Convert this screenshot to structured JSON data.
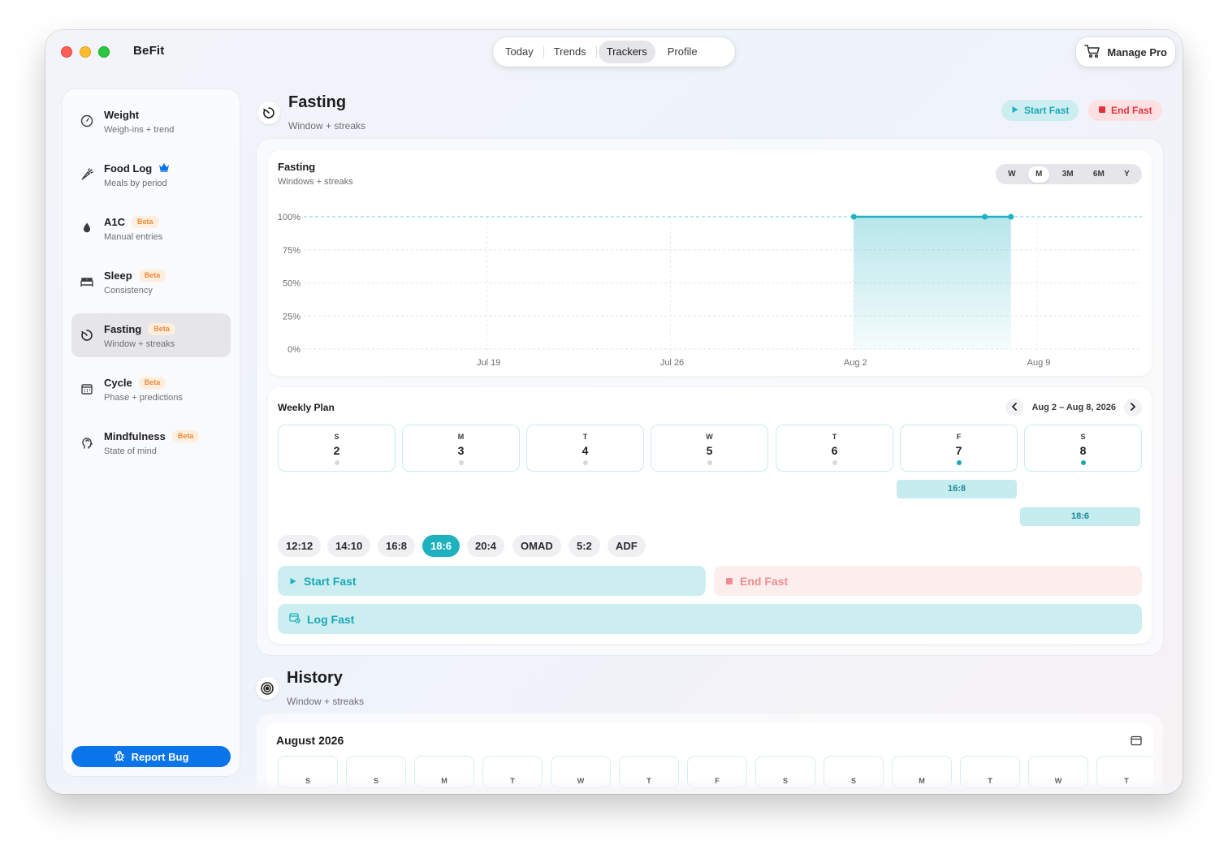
{
  "app": {
    "title": "BeFit"
  },
  "topnav": {
    "tabs": [
      "Today",
      "Trends",
      "Trackers",
      "Profile"
    ],
    "active": "Trackers"
  },
  "manage_pro": {
    "label": "Manage Pro",
    "icon": "cart-icon"
  },
  "sidebar": {
    "items": [
      {
        "name": "Weight",
        "sub": "Weigh-ins + trend",
        "icon": "scale-icon",
        "beta": "",
        "crown": false
      },
      {
        "name": "Food Log",
        "sub": "Meals by period",
        "icon": "carrot-icon",
        "beta": "",
        "crown": true
      },
      {
        "name": "A1C",
        "sub": "Manual entries",
        "icon": "drop-icon",
        "beta": "Beta",
        "crown": false
      },
      {
        "name": "Sleep",
        "sub": "Consistency",
        "icon": "bed-icon",
        "beta": "Beta",
        "crown": false
      },
      {
        "name": "Fasting",
        "sub": "Window + streaks",
        "icon": "timer-icon",
        "beta": "Beta",
        "crown": false,
        "active": true
      },
      {
        "name": "Cycle",
        "sub": "Phase + predictions",
        "icon": "calendar-icon",
        "beta": "Beta",
        "crown": false
      },
      {
        "name": "Mindfulness",
        "sub": "State of mind",
        "icon": "head-icon",
        "beta": "Beta",
        "crown": false
      }
    ],
    "report_bug": "Report Bug"
  },
  "fasting_header": {
    "title": "Fasting",
    "subtitle": "Window + streaks",
    "start_label": "Start Fast",
    "end_label": "End Fast"
  },
  "chart_card": {
    "title": "Fasting",
    "subtitle": "Windows + streaks",
    "ranges": [
      "W",
      "M",
      "3M",
      "6M",
      "Y"
    ],
    "active_range": "M"
  },
  "chart_data": {
    "type": "area",
    "x": [
      "Aug 2",
      "Aug 7",
      "Aug 8"
    ],
    "y": [
      100,
      100,
      100
    ],
    "x_ticks": [
      "Jul 19",
      "Jul 26",
      "Aug 2",
      "Aug 9"
    ],
    "y_ticks": [
      "0%",
      "25%",
      "50%",
      "75%",
      "100%"
    ],
    "ylim": [
      0,
      100
    ],
    "xlim": [
      "Jul 12",
      "Aug 13"
    ],
    "goal_line": 100,
    "grid": true,
    "color": "#1eb1c0"
  },
  "weekly_plan": {
    "title": "Weekly Plan",
    "range": "Aug 2 – Aug 8, 2026",
    "days": [
      {
        "letter": "S",
        "num": "2",
        "planned": false
      },
      {
        "letter": "M",
        "num": "3",
        "planned": false
      },
      {
        "letter": "T",
        "num": "4",
        "planned": false
      },
      {
        "letter": "W",
        "num": "5",
        "planned": false
      },
      {
        "letter": "T",
        "num": "6",
        "planned": false
      },
      {
        "letter": "F",
        "num": "7",
        "planned": true
      },
      {
        "letter": "S",
        "num": "8",
        "planned": true
      }
    ],
    "bars": [
      {
        "label": "16:8"
      },
      {
        "label": "18:6"
      }
    ],
    "protocols": [
      "12:12",
      "14:10",
      "16:8",
      "18:6",
      "20:4",
      "OMAD",
      "5:2",
      "ADF"
    ],
    "active_protocol": "18:6",
    "start_label": "Start Fast",
    "end_label": "End Fast",
    "log_label": "Log Fast"
  },
  "history": {
    "title": "History",
    "subtitle": "Window + streaks",
    "month": "August 2026",
    "weekday_letters": [
      "S",
      "S",
      "M",
      "T",
      "W",
      "T",
      "F",
      "S",
      "S",
      "M",
      "T",
      "W",
      "T"
    ]
  },
  "colors": {
    "accent": "#1eb1c0",
    "danger": "#e0343d",
    "brand_blue": "#0a74e9",
    "beta": "#ee8a3c"
  }
}
